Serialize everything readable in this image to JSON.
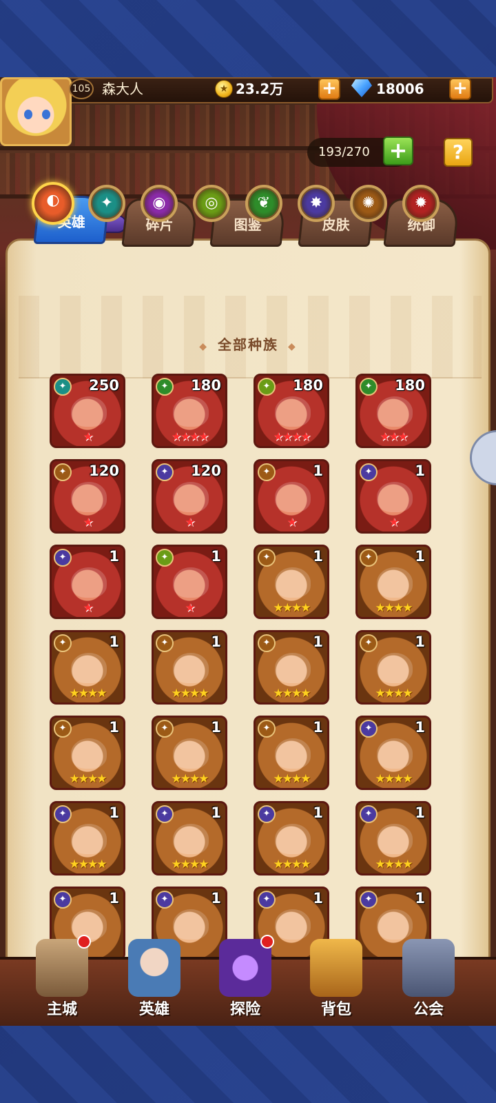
{
  "player": {
    "level": "105",
    "name": "森大人"
  },
  "currency": {
    "gold": "23.2万",
    "gems": "18006"
  },
  "capacity": "193/270",
  "help_label": "?",
  "tabs": [
    "英雄",
    "碎片",
    "图鉴",
    "皮肤",
    "统御"
  ],
  "race_filters": [
    {
      "icon": "all-races-icon",
      "color": "#e85c2a"
    },
    {
      "icon": "race-aqua-icon",
      "color": "#1b8f86"
    },
    {
      "icon": "race-purple-icon",
      "color": "#8a2aa8"
    },
    {
      "icon": "race-green-eye-icon",
      "color": "#6a9c16"
    },
    {
      "icon": "race-leaf-icon",
      "color": "#2e8c2a"
    },
    {
      "icon": "race-demon-icon",
      "color": "#4b3aa0"
    },
    {
      "icon": "race-light-icon",
      "color": "#9c5a16"
    },
    {
      "icon": "race-red-icon",
      "color": "#b12222"
    }
  ],
  "filter_label": "全部种族",
  "heroes": [
    {
      "level": "250",
      "stars": "★",
      "star_type": "red",
      "frame": "red",
      "race": "aqua"
    },
    {
      "level": "180",
      "stars": "★★★★",
      "star_type": "red",
      "frame": "red",
      "race": "leaf"
    },
    {
      "level": "180",
      "stars": "★★★★",
      "star_type": "red",
      "frame": "red",
      "race": "green-eye"
    },
    {
      "level": "180",
      "stars": "★★★",
      "star_type": "red",
      "frame": "red",
      "race": "leaf"
    },
    {
      "level": "120",
      "stars": "★",
      "star_type": "red",
      "frame": "red",
      "race": "light"
    },
    {
      "level": "120",
      "stars": "★",
      "star_type": "red",
      "frame": "red",
      "race": "demon"
    },
    {
      "level": "1",
      "stars": "★",
      "star_type": "red",
      "frame": "red",
      "race": "light"
    },
    {
      "level": "1",
      "stars": "★",
      "star_type": "red",
      "frame": "red",
      "race": "demon"
    },
    {
      "level": "1",
      "stars": "★",
      "star_type": "red",
      "frame": "red",
      "race": "demon"
    },
    {
      "level": "1",
      "stars": "★",
      "star_type": "red",
      "frame": "red",
      "race": "green-eye"
    },
    {
      "level": "1",
      "stars": "★★★★",
      "star_type": "gold",
      "frame": "gold",
      "race": "light"
    },
    {
      "level": "1",
      "stars": "★★★★",
      "star_type": "gold",
      "frame": "gold",
      "race": "light"
    },
    {
      "level": "1",
      "stars": "★★★★",
      "star_type": "gold",
      "frame": "gold",
      "race": "light"
    },
    {
      "level": "1",
      "stars": "★★★★",
      "star_type": "gold",
      "frame": "gold",
      "race": "light"
    },
    {
      "level": "1",
      "stars": "★★★★",
      "star_type": "gold",
      "frame": "gold",
      "race": "light"
    },
    {
      "level": "1",
      "stars": "★★★★",
      "star_type": "gold",
      "frame": "gold",
      "race": "light"
    },
    {
      "level": "1",
      "stars": "★★★★",
      "star_type": "gold",
      "frame": "gold",
      "race": "light"
    },
    {
      "level": "1",
      "stars": "★★★★",
      "star_type": "gold",
      "frame": "gold",
      "race": "light"
    },
    {
      "level": "1",
      "stars": "★★★★",
      "star_type": "gold",
      "frame": "gold",
      "race": "light"
    },
    {
      "level": "1",
      "stars": "★★★★",
      "star_type": "gold",
      "frame": "gold",
      "race": "demon"
    },
    {
      "level": "1",
      "stars": "★★★★",
      "star_type": "gold",
      "frame": "gold",
      "race": "demon"
    },
    {
      "level": "1",
      "stars": "★★★★",
      "star_type": "gold",
      "frame": "gold",
      "race": "demon"
    },
    {
      "level": "1",
      "stars": "★★★★",
      "star_type": "gold",
      "frame": "gold",
      "race": "demon"
    },
    {
      "level": "1",
      "stars": "★★★★",
      "star_type": "gold",
      "frame": "gold",
      "race": "demon"
    },
    {
      "level": "1",
      "stars": "",
      "star_type": "gold",
      "frame": "gold",
      "race": "demon"
    },
    {
      "level": "1",
      "stars": "",
      "star_type": "gold",
      "frame": "gold",
      "race": "demon"
    },
    {
      "level": "1",
      "stars": "",
      "star_type": "gold",
      "frame": "gold",
      "race": "demon"
    },
    {
      "level": "1",
      "stars": "",
      "star_type": "gold",
      "frame": "gold",
      "race": "demon"
    }
  ],
  "nav": [
    {
      "label": "主城",
      "icon": "castle-icon",
      "dot": true
    },
    {
      "label": "英雄",
      "icon": "hero-portrait-icon",
      "dot": false
    },
    {
      "label": "探险",
      "icon": "portal-icon",
      "dot": true
    },
    {
      "label": "背包",
      "icon": "backpack-icon",
      "dot": false
    },
    {
      "label": "公会",
      "icon": "guild-tower-icon",
      "dot": false
    }
  ]
}
